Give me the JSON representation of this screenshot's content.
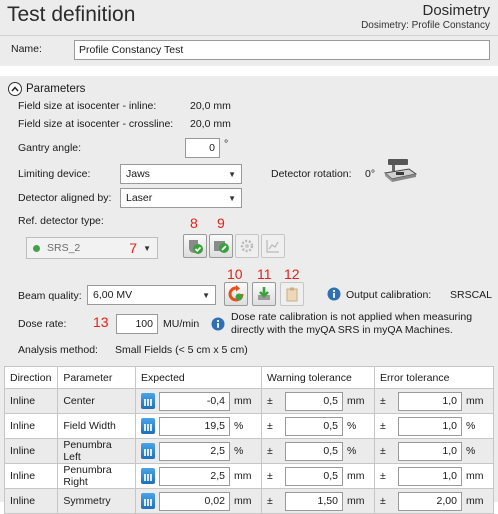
{
  "header": {
    "title": "Test definition",
    "app": "Dosimetry",
    "breadcrumb": "Dosimetry: Profile Constancy"
  },
  "name": {
    "label": "Name:",
    "value": "Profile Constancy Test"
  },
  "parameters": {
    "heading": "Parameters",
    "field_inline_label": "Field size at isocenter - inline:",
    "field_inline_value": "20,0 mm",
    "field_cross_label": "Field size at isocenter - crossline:",
    "field_cross_value": "20,0 mm",
    "gantry_label": "Gantry angle:",
    "gantry_value": "0",
    "gantry_unit": "°",
    "limiting_label": "Limiting device:",
    "limiting_value": "Jaws",
    "detector_rotation_label": "Detector rotation:",
    "detector_rotation_value": "0°",
    "aligned_label": "Detector aligned by:",
    "aligned_value": "Laser",
    "ref_label": "Ref. detector type:",
    "ref_value": "SRS_2",
    "annotation_7": "7",
    "annotation_8": "8",
    "annotation_9": "9",
    "annotation_10": "10",
    "annotation_11": "11",
    "annotation_12": "12",
    "annotation_13": "13",
    "beam_label": "Beam quality:",
    "beam_value": "6,00 MV",
    "output_cal_label": "Output calibration:",
    "output_cal_value": "SRSCAL",
    "dose_label": "Dose rate:",
    "dose_value": "100",
    "dose_unit": "MU/min",
    "dose_note_line1": "Dose rate calibration is not applied when measuring",
    "dose_note_line2": "directly with the myQA SRS in myQA Machines.",
    "analysis_label": "Analysis method:",
    "analysis_value": "Small Fields (< 5 cm x 5 cm)"
  },
  "table": {
    "headers": [
      "Direction",
      "Parameter",
      "Expected",
      "Warning tolerance",
      "Error tolerance"
    ],
    "rows": [
      {
        "direction": "Inline",
        "parameter": "Center",
        "expected": "-0,4",
        "expected_unit": "mm",
        "warn_pm": "±",
        "warn": "0,5",
        "warn_unit": "mm",
        "err_pm": "±",
        "err": "1,0",
        "err_unit": "mm"
      },
      {
        "direction": "Inline",
        "parameter": "Field Width",
        "expected": "19,5",
        "expected_unit": "%",
        "warn_pm": "±",
        "warn": "0,5",
        "warn_unit": "%",
        "err_pm": "±",
        "err": "1,0",
        "err_unit": "%"
      },
      {
        "direction": "Inline",
        "parameter": "Penumbra Left",
        "expected": "2,5",
        "expected_unit": "%",
        "warn_pm": "±",
        "warn": "0,5",
        "warn_unit": "%",
        "err_pm": "±",
        "err": "1,0",
        "err_unit": "%"
      },
      {
        "direction": "Inline",
        "parameter": "Penumbra Right",
        "expected": "2,5",
        "expected_unit": "mm",
        "warn_pm": "±",
        "warn": "0,5",
        "warn_unit": "mm",
        "err_pm": "±",
        "err": "1,0",
        "err_unit": "mm"
      },
      {
        "direction": "Inline",
        "parameter": "Symmetry",
        "expected": "0,02",
        "expected_unit": "mm",
        "warn_pm": "±",
        "warn": "1,50",
        "warn_unit": "mm",
        "err_pm": "±",
        "err": "2,00",
        "err_unit": "mm"
      }
    ]
  },
  "colors": {
    "annotation": "#e2231a",
    "panel": "#ececec",
    "info": "#2f6fb3"
  }
}
